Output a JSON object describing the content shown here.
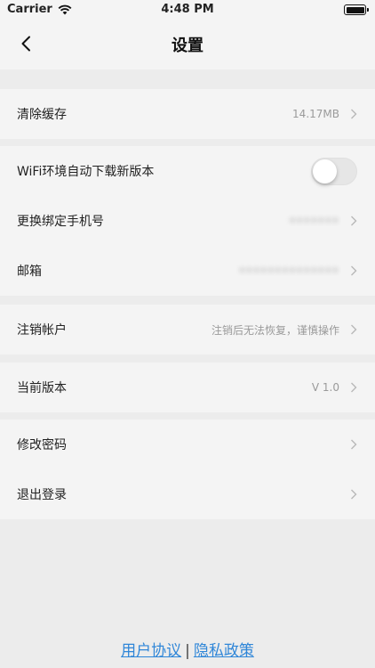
{
  "status_bar": {
    "carrier": "Carrier",
    "time": "4:48 PM"
  },
  "nav": {
    "title": "设置"
  },
  "groups": [
    {
      "rows": [
        {
          "label": "清除缓存",
          "value": "14.17MB"
        }
      ]
    },
    {
      "rows": [
        {
          "label": "WiFi环境自动下载新版本",
          "toggle": false
        },
        {
          "label": "更换绑定手机号",
          "value": "•••••••"
        },
        {
          "label": "邮箱",
          "value": "••••••••••••••"
        }
      ]
    },
    {
      "rows": [
        {
          "label": "注销帐户",
          "value": "注销后无法恢复，谨慎操作"
        }
      ]
    },
    {
      "rows": [
        {
          "label": "当前版本",
          "value": "V 1.0"
        }
      ]
    },
    {
      "rows": [
        {
          "label": "修改密码"
        },
        {
          "label": "退出登录"
        }
      ]
    }
  ],
  "footer": {
    "user_agreement": "用户协议",
    "separator": "|",
    "privacy_policy": "隐私政策"
  },
  "colors": {
    "background": "#ececec",
    "cell_background": "#f4f4f4",
    "link": "#2f86d8"
  }
}
